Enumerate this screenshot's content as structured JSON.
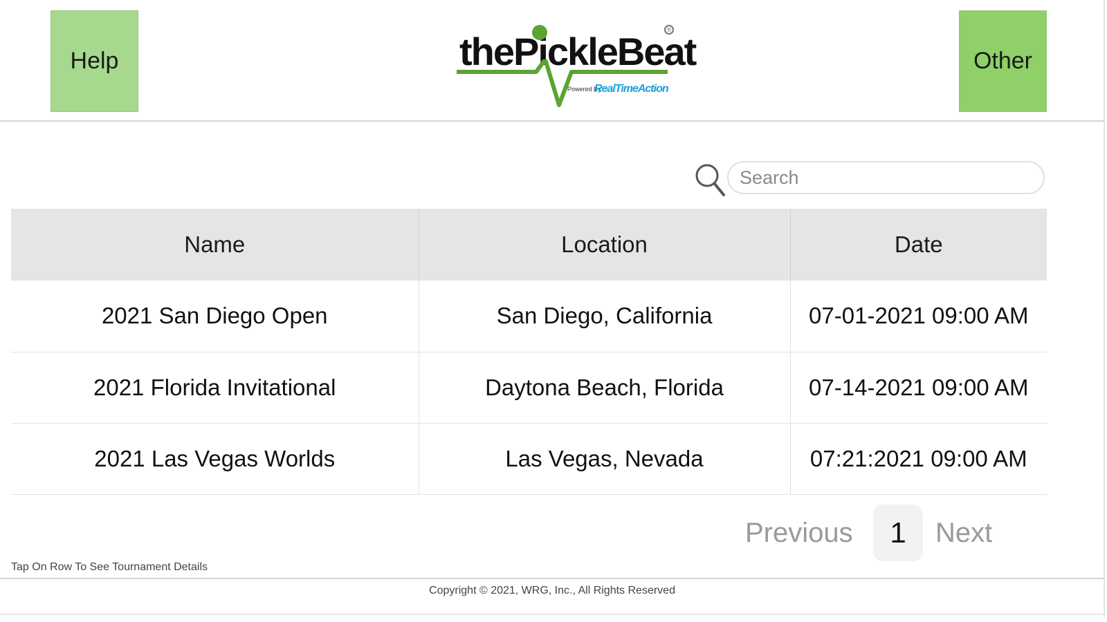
{
  "header": {
    "help_label": "Help",
    "other_label": "Other",
    "logo": {
      "text": "thePickleBeat",
      "powered_by": "Powered By",
      "brand": "RealTimeAction"
    }
  },
  "search": {
    "placeholder": "Search",
    "value": ""
  },
  "table": {
    "columns": [
      "Name",
      "Location",
      "Date"
    ],
    "rows": [
      {
        "name": "2021 San Diego Open",
        "location": "San Diego, California",
        "date": "07-01-2021 09:00 AM"
      },
      {
        "name": "2021 Florida Invitational",
        "location": "Daytona Beach, Florida",
        "date": "07-14-2021 09:00 AM"
      },
      {
        "name": "2021 Las Vegas Worlds",
        "location": "Las Vegas, Nevada",
        "date": "07:21:2021 09:00 AM"
      }
    ]
  },
  "pagination": {
    "previous_label": "Previous",
    "current_page": "1",
    "next_label": "Next"
  },
  "hint": "Tap On Row To See Tournament Details",
  "footer": {
    "copyright": "Copyright © 2021, WRG, Inc., All Rights Reserved"
  },
  "colors": {
    "help_button": "#a6d98e",
    "other_button": "#8fd068",
    "logo_green": "#5aa431",
    "brand_blue": "#1aa0d8",
    "header_row": "#e5e5e5"
  }
}
